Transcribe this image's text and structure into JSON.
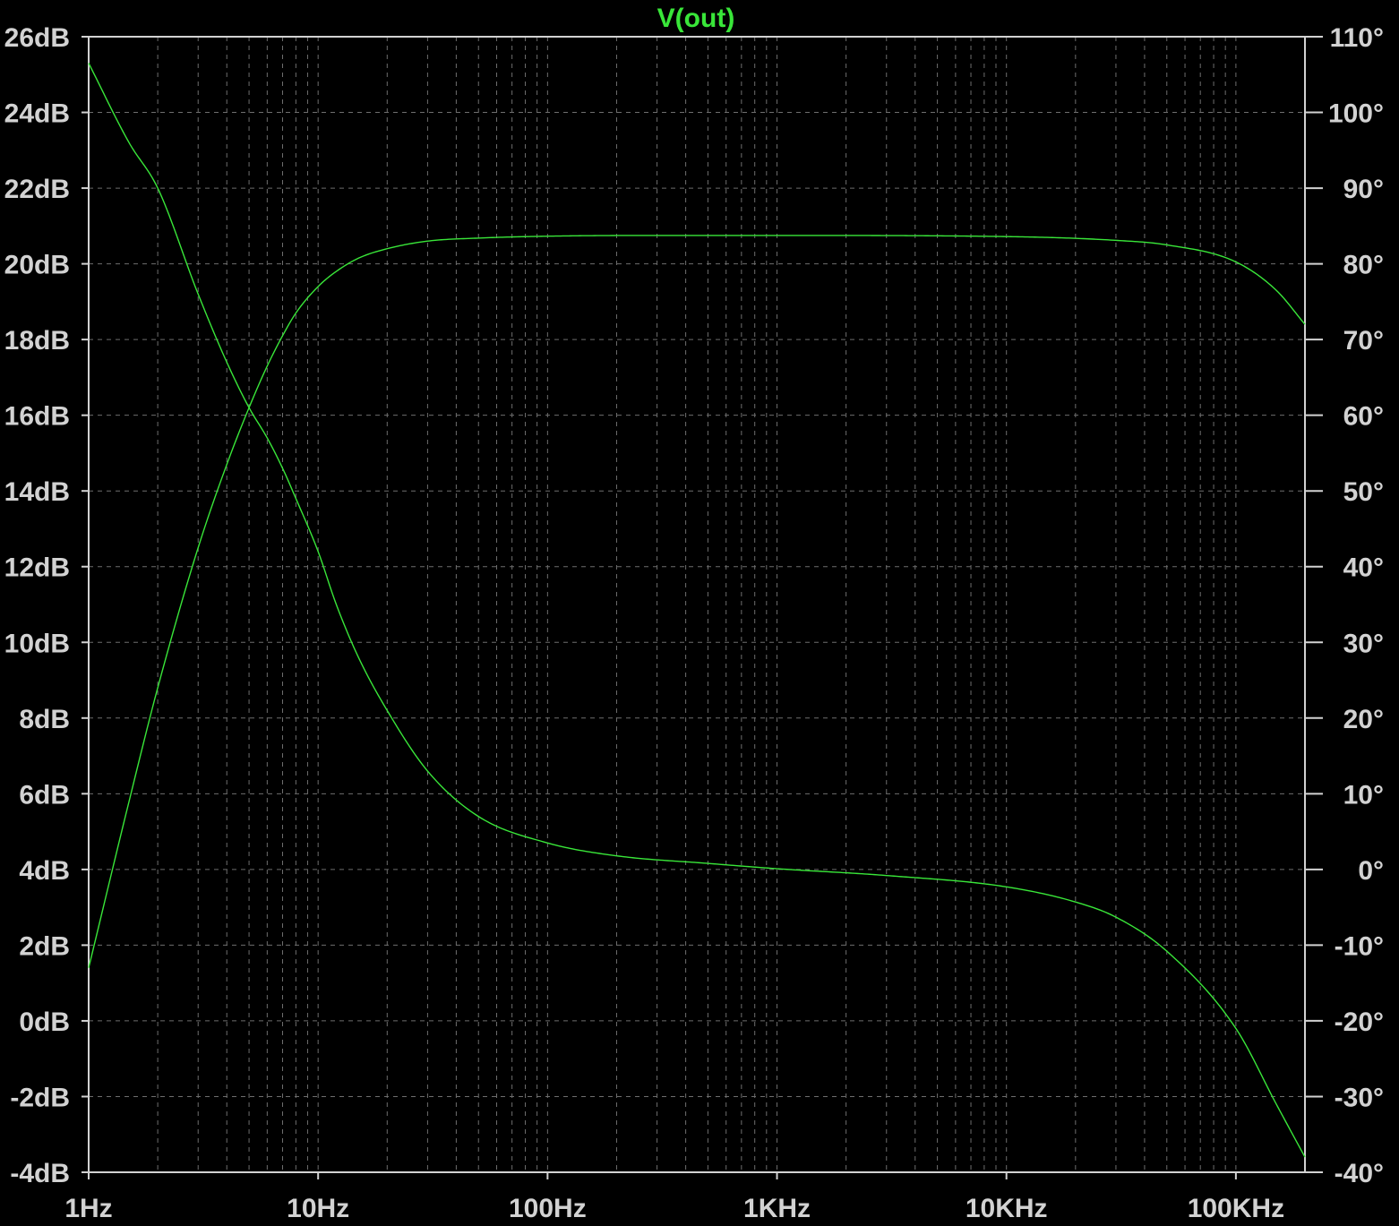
{
  "chart_data": {
    "type": "line",
    "title": "V(out)",
    "x_scale": "log",
    "xlim": [
      1,
      200000
    ],
    "x_ticks": [
      1,
      10,
      100,
      1000,
      10000,
      100000
    ],
    "x_tick_labels": [
      "1Hz",
      "10Hz",
      "100Hz",
      "1KHz",
      "10KHz",
      "100KHz"
    ],
    "ylim_left": [
      -4,
      26
    ],
    "y_ticks_left": [
      -4,
      -2,
      0,
      2,
      4,
      6,
      8,
      10,
      12,
      14,
      16,
      18,
      20,
      22,
      24,
      26
    ],
    "y_tick_labels_left": [
      "-4dB",
      "-2dB",
      "0dB",
      "2dB",
      "4dB",
      "6dB",
      "8dB",
      "10dB",
      "12dB",
      "14dB",
      "16dB",
      "18dB",
      "20dB",
      "22dB",
      "24dB",
      "26dB"
    ],
    "ylim_right": [
      -40,
      110
    ],
    "y_ticks_right": [
      -40,
      -30,
      -20,
      -10,
      0,
      10,
      20,
      30,
      40,
      50,
      60,
      70,
      80,
      90,
      100,
      110
    ],
    "y_tick_labels_right": [
      "-40°",
      "-30°",
      "-20°",
      "-10°",
      "0°",
      "10°",
      "20°",
      "30°",
      "40°",
      "50°",
      "60°",
      "70°",
      "80°",
      "90°",
      "100°",
      "110°"
    ],
    "grid": true,
    "series": [
      {
        "axis": "left",
        "color": "#39e639",
        "x": [
          1,
          1.5,
          2,
          3,
          4,
          5,
          6,
          7,
          8,
          10,
          12,
          15,
          20,
          30,
          50,
          100,
          300,
          1000,
          10000,
          30000,
          50000,
          100000,
          150000,
          200000
        ],
        "y": [
          1.4,
          5.8,
          8.8,
          12.5,
          14.7,
          16.2,
          17.3,
          18.1,
          18.7,
          19.4,
          19.8,
          20.15,
          20.4,
          20.6,
          20.68,
          20.73,
          20.75,
          20.75,
          20.72,
          20.62,
          20.5,
          20.05,
          19.3,
          18.4
        ]
      },
      {
        "axis": "right",
        "color": "#39e639",
        "x": [
          1,
          1.5,
          2,
          3,
          4,
          5,
          6,
          7,
          8,
          10,
          12,
          15,
          20,
          30,
          50,
          100,
          200,
          500,
          1000,
          3000,
          10000,
          20000,
          30000,
          50000,
          100000,
          150000,
          200000
        ],
        "y": [
          106.5,
          96,
          90,
          76,
          67,
          61,
          57,
          53,
          49,
          42,
          35,
          28,
          21,
          13,
          7,
          3.5,
          1.8,
          0.8,
          0.1,
          -0.8,
          -2.3,
          -4.3,
          -6.3,
          -10.8,
          -21,
          -31,
          -38
        ]
      }
    ]
  }
}
